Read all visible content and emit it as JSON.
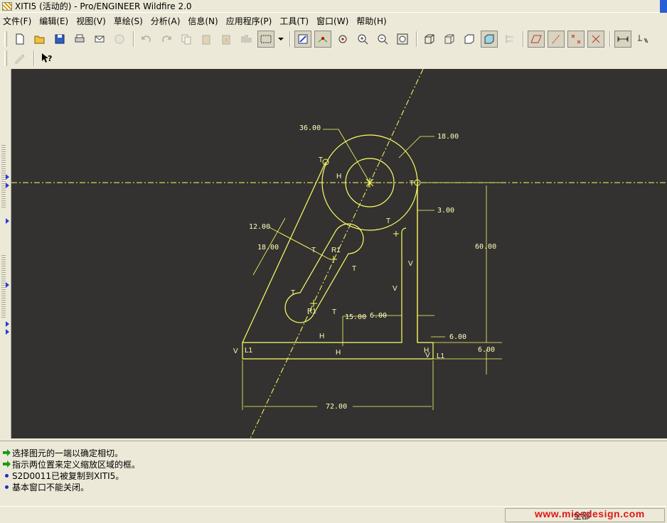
{
  "window": {
    "title": "XITI5 (活动的) - Pro/ENGINEER Wildfire 2.0"
  },
  "menu": [
    "文件(F)",
    "编辑(E)",
    "视图(V)",
    "草绘(S)",
    "分析(A)",
    "信息(N)",
    "应用程序(P)",
    "工具(T)",
    "窗口(W)",
    "帮助(H)"
  ],
  "drawing": {
    "dimensions": {
      "d1": "36.00",
      "d2": "18.00",
      "d3": "3.00",
      "d4": "12.00",
      "d5": "18.00",
      "d6": "60.00",
      "d7": "15.00",
      "d8": "6.00",
      "d9": "6.00",
      "d10": "6.00",
      "d11": "72.00"
    },
    "constraints": {
      "T": "T",
      "H": "H",
      "V": "V",
      "R1": "R1",
      "L1": "L1"
    }
  },
  "messages": [
    {
      "kind": "prompt",
      "text": "选择图元的一端以确定相切。"
    },
    {
      "kind": "prompt",
      "text": "指示两位置来定义缩放区域的框。"
    },
    {
      "kind": "info",
      "text": "S2D0011已被复制到XITI5。"
    },
    {
      "kind": "info",
      "text": "基本窗口不能关闭。"
    }
  ],
  "status": {
    "filter_value": "全部",
    "watermark": "www.missdesign.com"
  },
  "colors": {
    "canvas_bg": "#333230",
    "sketch": "#ffff66",
    "accent_watermark": "#e01818"
  }
}
